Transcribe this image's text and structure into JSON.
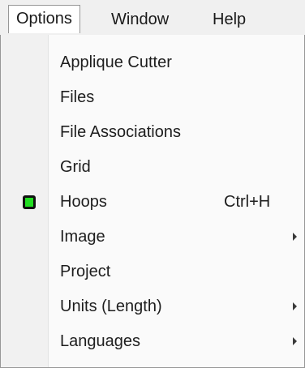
{
  "menubar": {
    "items": [
      {
        "label": "Options"
      },
      {
        "label": "Window"
      },
      {
        "label": "Help"
      }
    ]
  },
  "menu": {
    "items": [
      {
        "label": "Applique Cutter"
      },
      {
        "label": "Files"
      },
      {
        "label": "File Associations"
      },
      {
        "label": "Grid"
      },
      {
        "label": "Hoops",
        "shortcut": "Ctrl+H",
        "checked": true
      },
      {
        "label": "Image",
        "submenu": true
      },
      {
        "label": "Project"
      },
      {
        "label": "Units (Length)",
        "submenu": true
      },
      {
        "label": "Languages",
        "submenu": true
      }
    ]
  },
  "colors": {
    "check_indicator": "#22dd22"
  }
}
